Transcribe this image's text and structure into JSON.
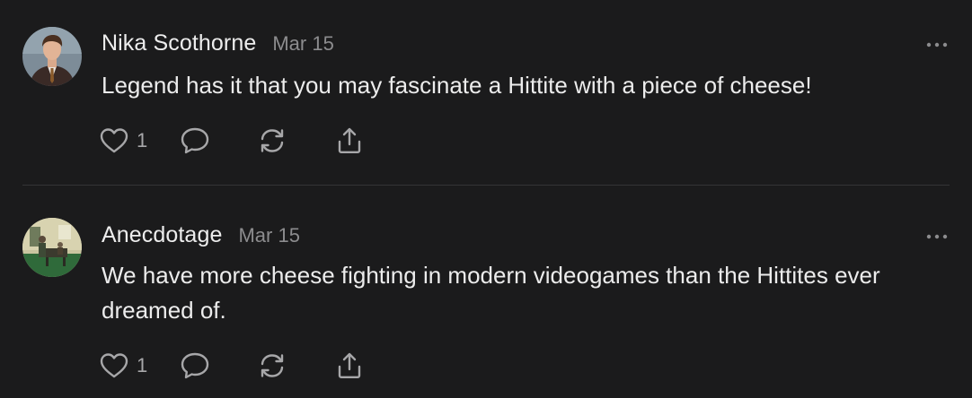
{
  "comments": [
    {
      "author": "Nika Scothorne",
      "date": "Mar 15",
      "text": "Legend has it that you may fascinate a Hittite with a piece of cheese!",
      "likes": "1",
      "avatar": "man-in-suit-photo"
    },
    {
      "author": "Anecdotage",
      "date": "Mar 15",
      "text": "We have more cheese fighting in modern videogames than the Hittites ever dreamed of.",
      "likes": "1",
      "avatar": "painting-room-scene"
    }
  ],
  "icons": {
    "like": "heart-icon",
    "comment": "speech-bubble-icon",
    "restack": "refresh-icon",
    "share": "share-icon",
    "more": "ellipsis-icon"
  },
  "colors": {
    "background": "#1b1b1c",
    "text": "#ececec",
    "muted": "#8c8c8e",
    "icon": "#a7a7a9",
    "divider": "#343436"
  }
}
